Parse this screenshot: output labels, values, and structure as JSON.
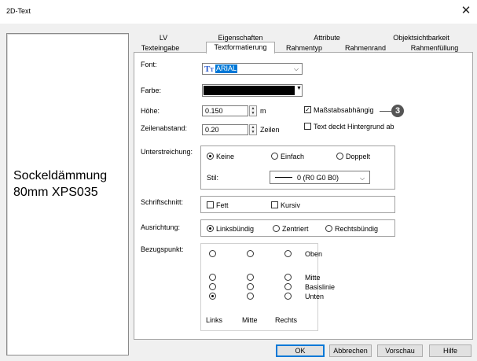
{
  "window": {
    "title": "2D-Text",
    "close_icon": "close-icon"
  },
  "preview": {
    "line1": "Sockeldämmung",
    "line2": "80mm XPS035"
  },
  "tabs": {
    "row1": [
      "LV",
      "Eigenschaften",
      "Attribute",
      "Objektsichtbarkeit"
    ],
    "row2": [
      "Texteingabe",
      "Textformatierung",
      "Rahmentyp",
      "Rahmenrand",
      "Rahmenfüllung"
    ],
    "active": "Textformatierung"
  },
  "form": {
    "font_label": "Font:",
    "font_value": "ARIAL",
    "farbe_label": "Farbe:",
    "hoehe_label": "Höhe:",
    "hoehe_value": "0.150",
    "hoehe_unit": "m",
    "zeilen_label": "Zeilenabstand:",
    "zeilen_value": "0.20",
    "zeilen_unit": "Zeilen",
    "massstab_label": "Maßstabsabhängig",
    "massstab_checked": true,
    "callout_number": "3",
    "textdeckt_label": "Text deckt Hintergrund ab",
    "textdeckt_checked": false,
    "unterstreichung_label": "Unterstreichung:",
    "unterstreichung_options": [
      "Keine",
      "Einfach",
      "Doppelt"
    ],
    "unterstreichung_selected": "Keine",
    "stil_label": "Stil:",
    "stil_value": "0 (R0 G0 B0)",
    "schriftschnitt_label": "Schriftschnitt:",
    "fett_label": "Fett",
    "kursiv_label": "Kursiv",
    "ausrichtung_label": "Ausrichtung:",
    "ausrichtung_options": [
      "Linksbündig",
      "Zentriert",
      "Rechtsbündig"
    ],
    "ausrichtung_selected": "Linksbündig",
    "bezug_label": "Bezugspunkt:",
    "bezug_rows": [
      "Oben",
      "Mitte",
      "Basislinie",
      "Unten"
    ],
    "bezug_cols": [
      "Links",
      "Mitte",
      "Rechts"
    ],
    "bezug_selected": "Unten-Links"
  },
  "buttons": {
    "ok": "OK",
    "abbrechen": "Abbrechen",
    "vorschau": "Vorschau",
    "hilfe": "Hilfe"
  },
  "colors": {
    "accent": "#0078d7",
    "callout": "#555555",
    "font_icon": "#2255cc",
    "selection": "#0078d7"
  }
}
